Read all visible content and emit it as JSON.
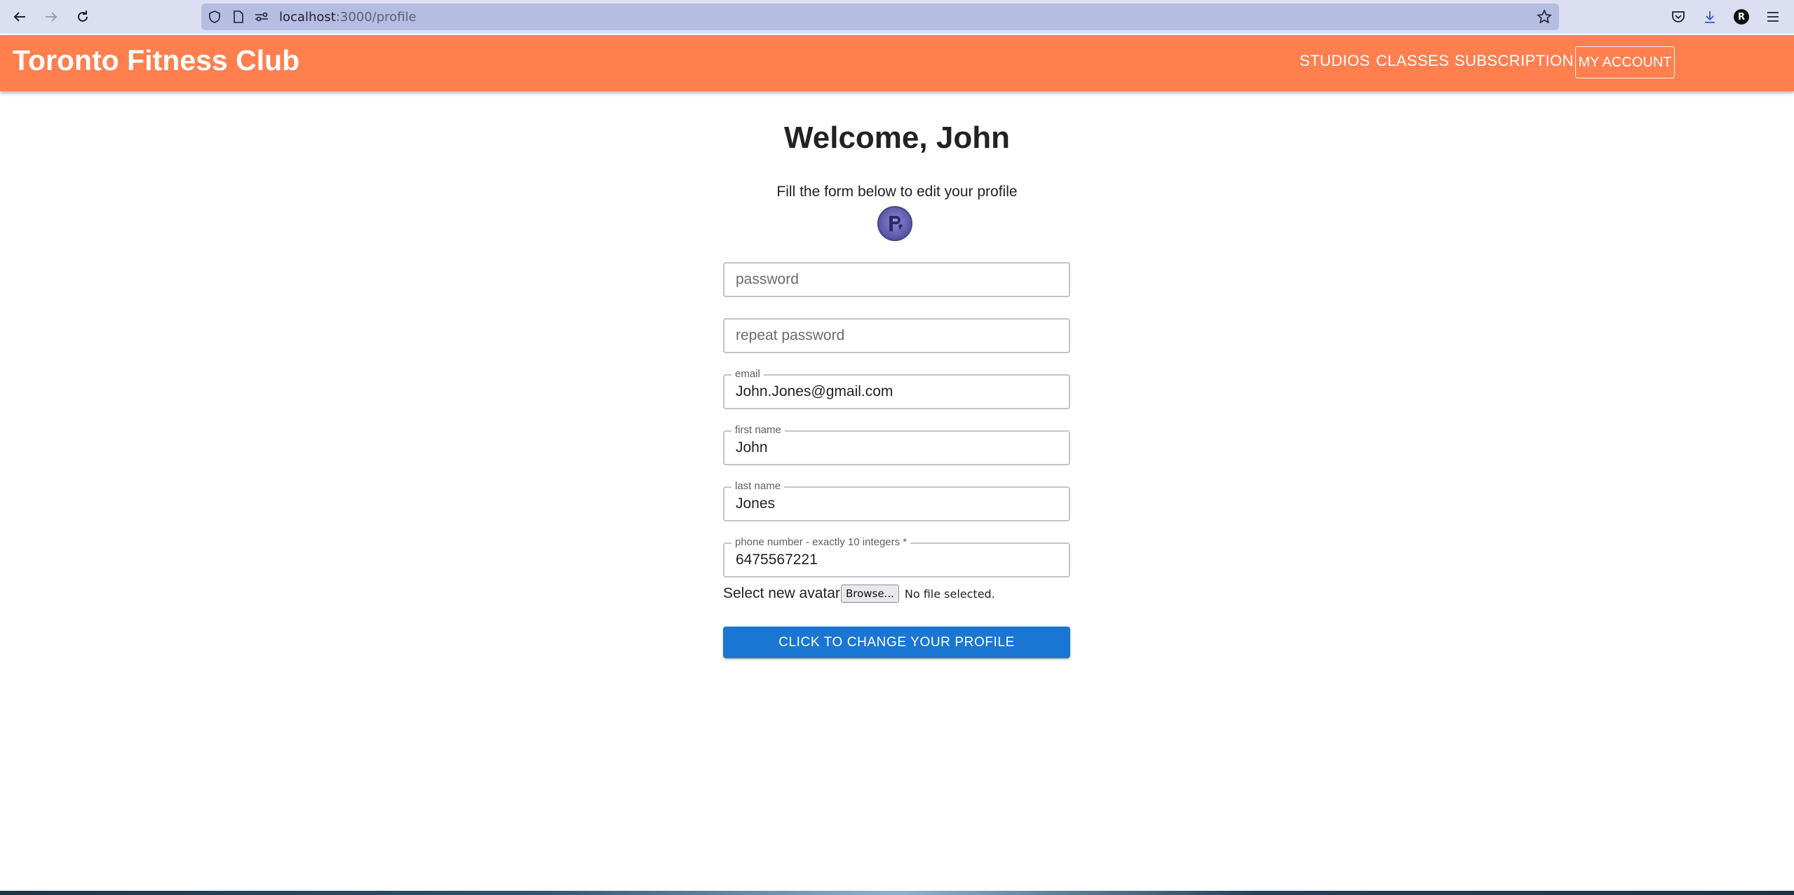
{
  "browser": {
    "url_host": "localhost",
    "url_path": ":3000/profile",
    "profile_initial": "R",
    "icons": [
      "back-arrow-icon",
      "forward-arrow-icon",
      "reload-icon",
      "shield-icon",
      "page-icon",
      "permissions-icon",
      "star-icon",
      "pocket-icon",
      "download-icon",
      "menu-icon"
    ]
  },
  "header": {
    "brand": "Toronto Fitness Club",
    "nav": [
      "STUDIOS",
      "CLASSES",
      "SUBSCRIPTION"
    ],
    "account_button": "MY ACCOUNT",
    "color": "#ff7f4f"
  },
  "main": {
    "title": "Welcome, John",
    "subtitle": "Fill the form below to edit your profile",
    "avatar_icon": "avatar-image",
    "fields": {
      "password": {
        "placeholder": "password",
        "value": ""
      },
      "repeat_password": {
        "placeholder": "repeat password",
        "value": ""
      },
      "email": {
        "label": "email",
        "value": "John.Jones@gmail.com"
      },
      "first_name": {
        "label": "first name",
        "value": "John"
      },
      "last_name": {
        "label": "last name",
        "value": "Jones"
      },
      "phone": {
        "label": "phone number - exactly 10 integers *",
        "value": "6475567221"
      }
    },
    "avatar_upload": {
      "label": "Select new avatar",
      "browse_label": "Browse...",
      "status": "No file selected."
    },
    "submit_label": "CLICK TO CHANGE YOUR PROFILE",
    "submit_color": "#1976d2"
  }
}
